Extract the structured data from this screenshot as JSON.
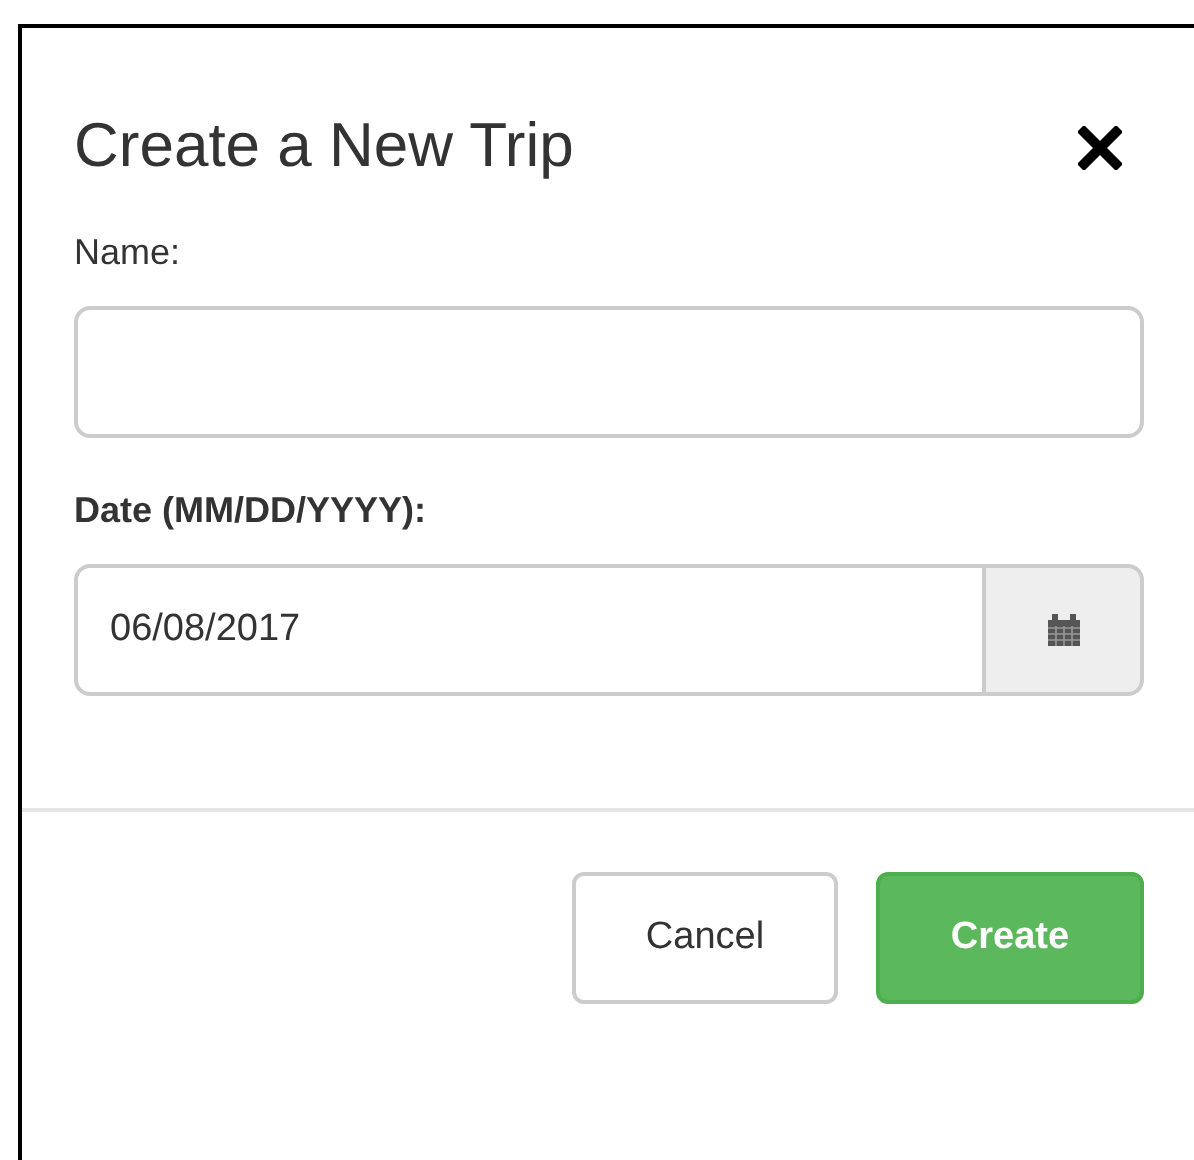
{
  "dialog": {
    "title": "Create a New Trip"
  },
  "fields": [
    {
      "label": "Name:",
      "emphasized": false,
      "has_calendar": false
    },
    {
      "label": "Date (MM/DD/YYYY):",
      "emphasized": true,
      "value": "06/08/2017",
      "has_calendar": true
    }
  ],
  "buttons": [
    {
      "label": "Cancel",
      "kind": "secondary"
    },
    {
      "label": "Create",
      "kind": "primary"
    }
  ]
}
